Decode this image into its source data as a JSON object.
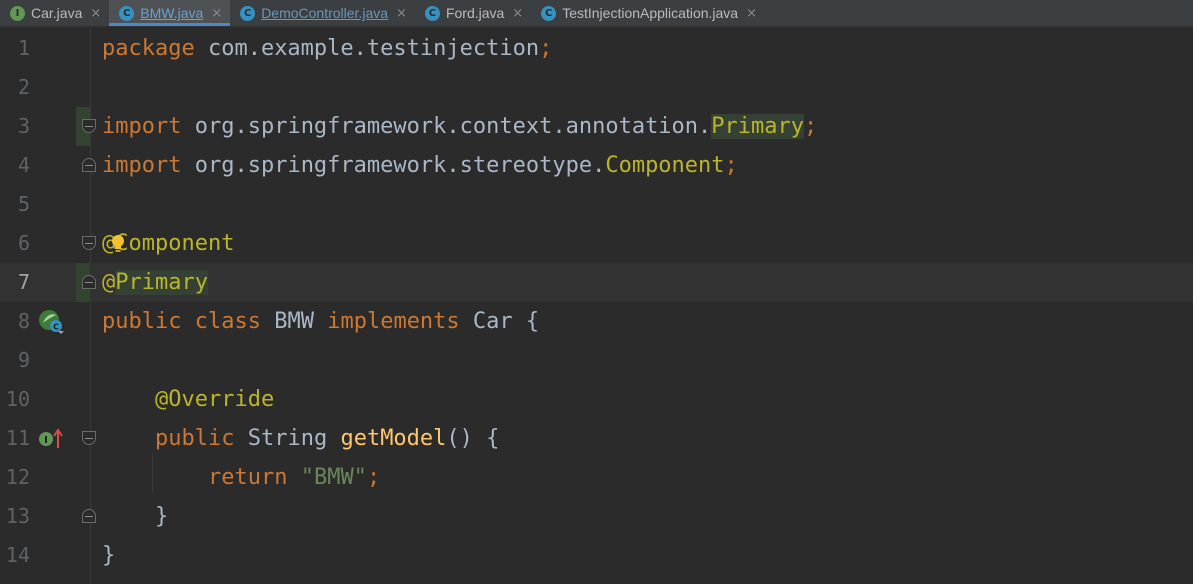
{
  "tabs": [
    {
      "label": "Car.java",
      "icon": "I",
      "icon_color": "#629755",
      "active": false
    },
    {
      "label": "BMW.java",
      "icon": "C",
      "icon_color": "#3592c4",
      "active": true
    },
    {
      "label": "DemoController.java",
      "icon": "C",
      "icon_color": "#3592c4",
      "active": false
    },
    {
      "label": "Ford.java",
      "icon": "C",
      "icon_color": "#3592c4",
      "active": false
    },
    {
      "label": "TestInjectionApplication.java",
      "icon": "C",
      "icon_color": "#3592c4",
      "active": false
    }
  ],
  "close_glyph": "×",
  "line_numbers": [
    "1",
    "2",
    "3",
    "4",
    "5",
    "6",
    "7",
    "8",
    "9",
    "10",
    "11",
    "12",
    "13",
    "14"
  ],
  "code": {
    "l1": {
      "kw": "package",
      "rest": " com.example.testinjection",
      "semi": ";"
    },
    "l3": {
      "kw": "import",
      "rest": " org.springframework.context.annotation.",
      "cls": "Primary",
      "semi": ";"
    },
    "l4": {
      "kw": "import",
      "rest": " org.springframework.stereotype.",
      "cls": "Component",
      "semi": ";"
    },
    "l6": {
      "at": "@",
      "ann": "Component"
    },
    "l7": {
      "at": "@",
      "ann": "Primary"
    },
    "l8": {
      "kw1": "public",
      "kw2": "class",
      "name": "BMW",
      "kw3": "implements",
      "iface": "Car",
      "brace": "{"
    },
    "l10": {
      "ann": "@Override"
    },
    "l11": {
      "kw": "public",
      "type": "String",
      "fn": "getModel",
      "rest": "() {"
    },
    "l12": {
      "kw": "return",
      "str": "\"BMW\"",
      "semi": ";"
    },
    "l13": {
      "brace": "}"
    },
    "l14": {
      "brace": "}"
    }
  },
  "colors": {
    "keyword": "#cc7832",
    "annotation": "#bbb529",
    "string": "#6a8759",
    "function": "#ffc66d",
    "text": "#a9b7c6"
  }
}
